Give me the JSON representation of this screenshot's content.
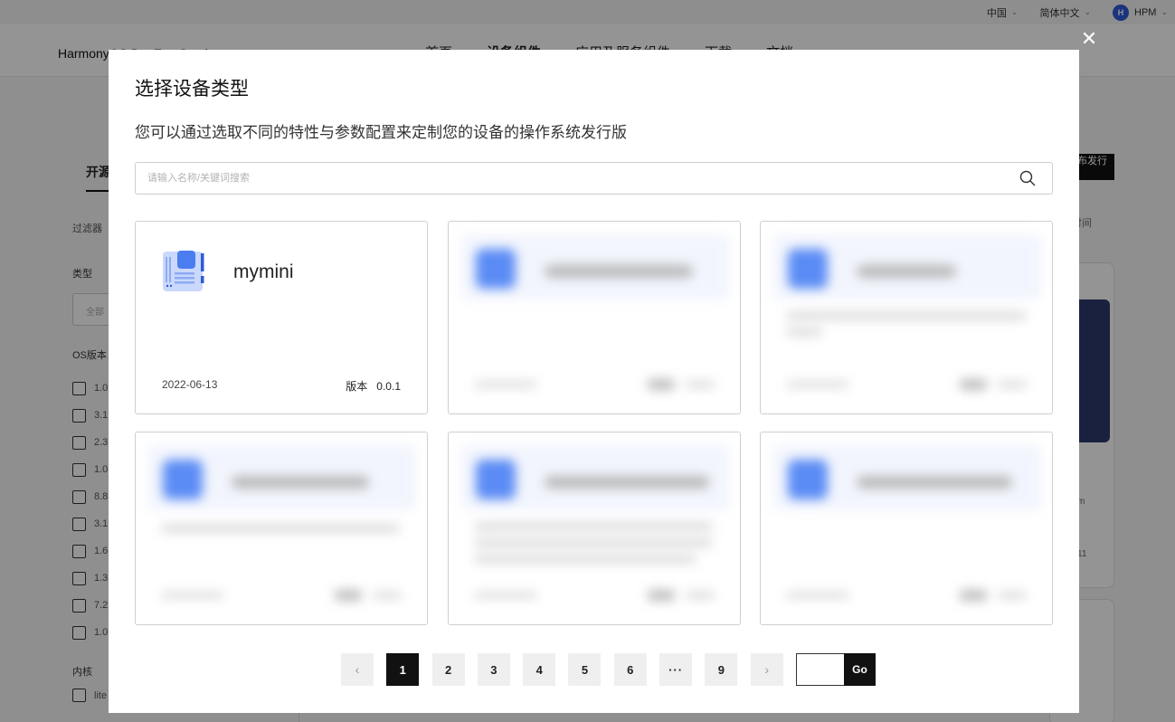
{
  "topbar": {
    "region": "中国",
    "language": "简体中文",
    "account": "HPM",
    "account_logo_text": "H"
  },
  "mainnav": {
    "brand": "HarmonyOS DevEco Services",
    "links": [
      "首页",
      "设备组件",
      "应用及服务组件",
      "下载",
      "文档"
    ],
    "active_index": 1
  },
  "background": {
    "tab_label": "开源发行版",
    "filter_label": "过滤器",
    "type_label": "类型",
    "select_placeholder": "全部",
    "os_label": "OS版本",
    "os_versions": [
      "1.0",
      "3.1",
      "2.3",
      "1.0",
      "8.8",
      "3.1",
      "1.6",
      "1.3",
      "7.2",
      "1.0"
    ],
    "kernel_label": "内核",
    "kernel_option": "lite",
    "publish_button": "发布发行版",
    "sort_label": "时间",
    "card_text_1": "m",
    "card_text_2": "11"
  },
  "modal": {
    "title": "选择设备类型",
    "subtitle": "您可以通过选取不同的特性与参数配置来定制您的设备的操作系统发行版",
    "search_placeholder": "请输入名称/关键词搜索",
    "close_glyph": "✕",
    "cards": [
      {
        "name": "mymini",
        "date": "2022-06-13",
        "version_label": "版本",
        "version": "0.0.1",
        "icon": "board-icon"
      }
    ],
    "blurred_card_count": 5,
    "pagination": {
      "prev": "‹",
      "next": "›",
      "pages": [
        "1",
        "2",
        "3",
        "4",
        "5",
        "6",
        "···",
        "9"
      ],
      "active_page": "1",
      "goto_value": "",
      "go_label": "Go"
    }
  },
  "colors": {
    "accent": "#111111",
    "icon_blue": "#4b7cf0",
    "overlay": "rgba(0,0,0,0.42)"
  }
}
